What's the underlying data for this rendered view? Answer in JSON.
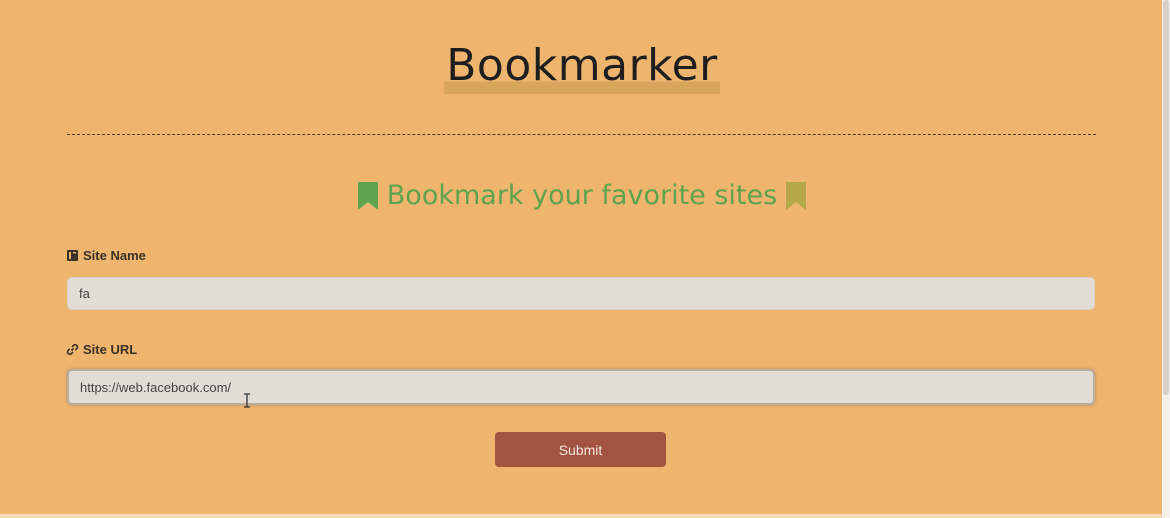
{
  "header": {
    "title": "Bookmarker"
  },
  "subheader": {
    "text": "Bookmark your favorite sites",
    "icons": [
      "bookmark-icon",
      "bookmark-icon"
    ],
    "color": "#5ea34e"
  },
  "form": {
    "site_name": {
      "label": "Site Name",
      "icon": "book-icon",
      "value": "fa"
    },
    "site_url": {
      "label": "Site URL",
      "icon": "link-icon",
      "value": "https://web.facebook.com/"
    },
    "submit_label": "Submit"
  },
  "colors": {
    "background": "#efb56e",
    "input_bg": "#e2dcd5",
    "submit_bg": "#a35440"
  }
}
